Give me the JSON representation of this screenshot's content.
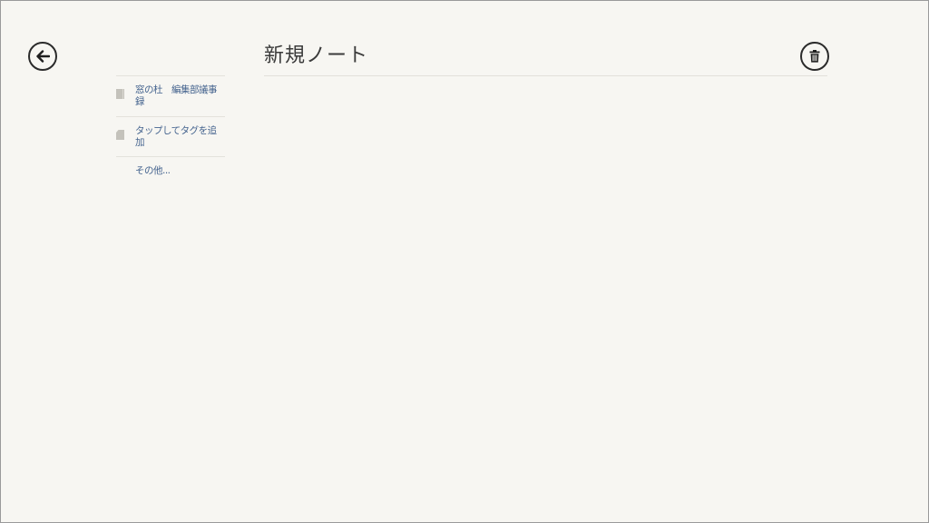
{
  "header": {
    "back_icon": "arrow-left-icon",
    "delete_icon": "trash-icon"
  },
  "note": {
    "title": "新規ノート"
  },
  "sidebar": {
    "items": [
      {
        "icon": "notebook-icon",
        "label": "窓の杜　編集部議事録"
      },
      {
        "icon": "tag-icon",
        "label": "タップしてタグを追加"
      },
      {
        "label": "その他..."
      }
    ]
  },
  "colors": {
    "background": "#f7f6f2",
    "text": "#3a3a3a",
    "link": "#44638e",
    "icon_gray": "#c4c2bb",
    "divider": "#e2e0da"
  }
}
